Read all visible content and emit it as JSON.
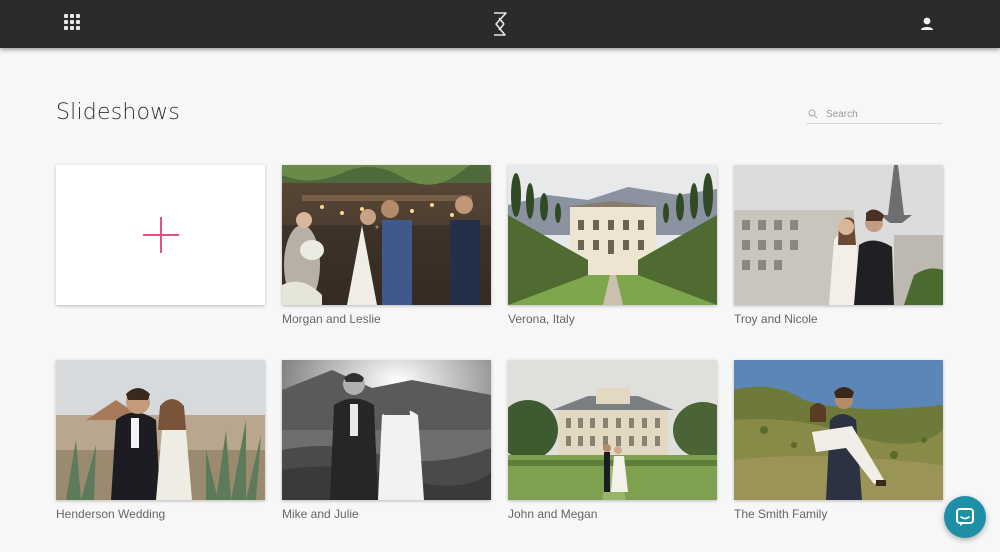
{
  "header": {
    "apps_icon": "grid-icon",
    "logo_icon": "hourglass-logo-icon",
    "user_icon": "user-icon"
  },
  "page": {
    "title": "Slideshows"
  },
  "search": {
    "placeholder": "Search",
    "value": "",
    "icon": "search-icon"
  },
  "new_slideshow": {
    "icon": "plus-icon",
    "accent_color": "#e2527e"
  },
  "slideshows": [
    {
      "caption": "Morgan and Leslie",
      "scene": "outdoor wedding ceremony, couple kissing under pergola with lights"
    },
    {
      "caption": "Verona, Italy",
      "scene": "villa with tall hedges and cypress trees"
    },
    {
      "caption": "Troy and Nicole",
      "scene": "couple embracing with Eiffel Tower behind"
    },
    {
      "caption": "Henderson Wedding",
      "scene": "groom in tuxedo and bride among agave plants"
    },
    {
      "caption": "Mike and Julie",
      "scene": "black and white couple in mountain meadow"
    },
    {
      "caption": "John and Megan",
      "scene": "couple on lawn in front of chateau"
    },
    {
      "caption": "The Smith Family",
      "scene": "man carrying woman on grassy hillside"
    }
  ],
  "chat": {
    "icon": "chat-bubble-icon",
    "color": "#1f8fa8"
  }
}
